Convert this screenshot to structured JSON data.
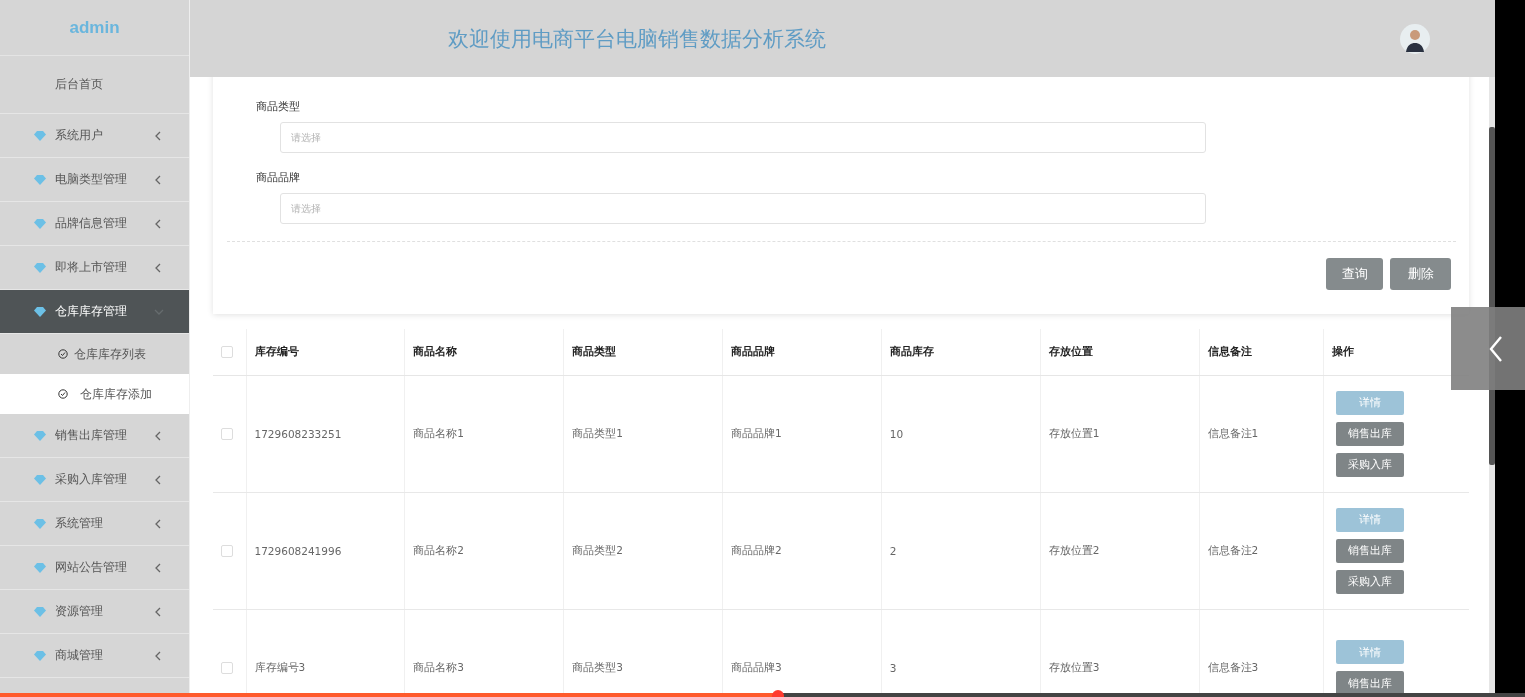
{
  "sidebar": {
    "brand": "admin",
    "items": [
      {
        "label": "后台首页",
        "kind": "home"
      },
      {
        "label": "系统用户",
        "kind": "menu",
        "expanded": false
      },
      {
        "label": "电脑类型管理",
        "kind": "menu",
        "expanded": false
      },
      {
        "label": "品牌信息管理",
        "kind": "menu",
        "expanded": false
      },
      {
        "label": "即将上市管理",
        "kind": "menu",
        "expanded": false
      },
      {
        "label": "仓库库存管理",
        "kind": "menu",
        "expanded": true,
        "children": [
          {
            "label": "仓库库存列表",
            "selected": false
          },
          {
            "label": "仓库库存添加",
            "selected": true
          }
        ]
      },
      {
        "label": "销售出库管理",
        "kind": "menu",
        "expanded": false
      },
      {
        "label": "采购入库管理",
        "kind": "menu",
        "expanded": false
      },
      {
        "label": "系统管理",
        "kind": "menu",
        "expanded": false
      },
      {
        "label": "网站公告管理",
        "kind": "menu",
        "expanded": false
      },
      {
        "label": "资源管理",
        "kind": "menu",
        "expanded": false
      },
      {
        "label": "商城管理",
        "kind": "menu",
        "expanded": false
      }
    ]
  },
  "header": {
    "title": "欢迎使用电商平台电脑销售数据分析系统"
  },
  "search_form": {
    "fields": [
      {
        "label": "商品类型",
        "placeholder": "请选择"
      },
      {
        "label": "商品品牌",
        "placeholder": "请选择"
      }
    ],
    "buttons": [
      "查询",
      "删除"
    ]
  },
  "table": {
    "all_checked": false,
    "columns": [
      "库存编号",
      "商品名称",
      "商品类型",
      "商品品牌",
      "商品库存",
      "存放位置",
      "信息备注",
      "操作"
    ],
    "rows": [
      {
        "checked": false,
        "cells": [
          "1729608233251",
          "商品名称1",
          "商品类型1",
          "商品品牌1",
          "10",
          "存放位置1",
          "信息备注1"
        ],
        "actions": [
          {
            "label": "详情",
            "kind": "detail"
          },
          {
            "label": "销售出库",
            "kind": "sale"
          },
          {
            "label": "采购入库",
            "kind": "purchase"
          }
        ]
      },
      {
        "checked": false,
        "cells": [
          "1729608241996",
          "商品名称2",
          "商品类型2",
          "商品品牌2",
          "2",
          "存放位置2",
          "信息备注2"
        ],
        "actions": [
          {
            "label": "详情",
            "kind": "detail"
          },
          {
            "label": "销售出库",
            "kind": "sale"
          },
          {
            "label": "采购入库",
            "kind": "purchase"
          }
        ]
      },
      {
        "checked": false,
        "cells": [
          "库存编号3",
          "商品名称3",
          "商品类型3",
          "商品品牌3",
          "3",
          "存放位置3",
          "信息备注3"
        ],
        "actions": [
          {
            "label": "详情",
            "kind": "detail"
          },
          {
            "label": "销售出库",
            "kind": "sale"
          }
        ]
      }
    ]
  },
  "video_progress": {
    "level": 0.51
  }
}
